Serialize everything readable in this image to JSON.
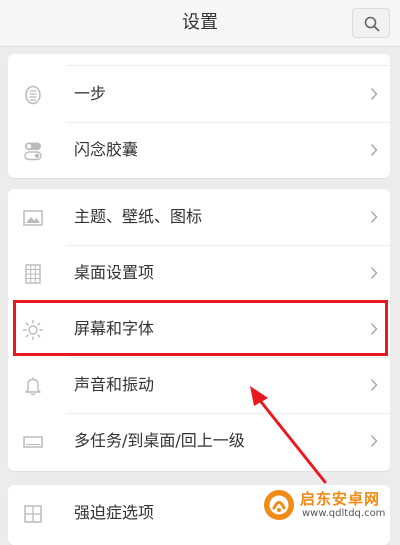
{
  "header": {
    "title": "设置",
    "search_icon": "search-icon"
  },
  "group1": {
    "items": [
      {
        "label": "",
        "icon": "partial-top-item"
      },
      {
        "label": "一步",
        "icon": "one-step-icon"
      },
      {
        "label": "闪念胶囊",
        "icon": "capsule-toggle-icon"
      }
    ]
  },
  "group2": {
    "items": [
      {
        "label": "主题、壁纸、图标",
        "icon": "image-icon"
      },
      {
        "label": "桌面设置项",
        "icon": "grid-icon"
      },
      {
        "label": "屏幕和字体",
        "icon": "brightness-icon"
      },
      {
        "label": "声音和振动",
        "icon": "bell-icon"
      },
      {
        "label": "多任务/到桌面/回上一级",
        "icon": "rectangle-icon"
      }
    ]
  },
  "group3": {
    "items": [
      {
        "label": "强迫症选项",
        "icon": "grid-square-icon"
      }
    ]
  },
  "annotation": {
    "highlight_color": "#e8191f"
  },
  "watermark": {
    "title": "启东安卓网",
    "url": "www.qdltdq.com"
  }
}
